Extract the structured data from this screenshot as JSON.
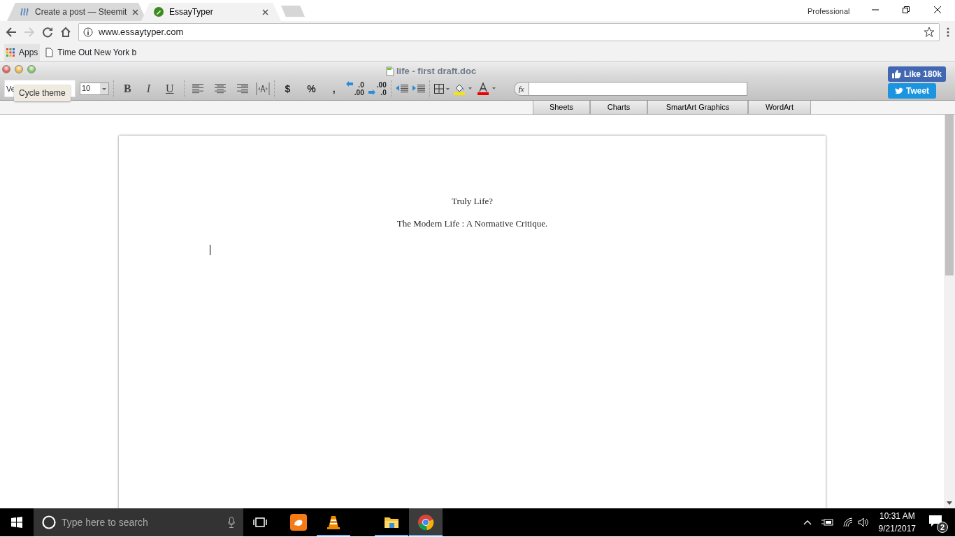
{
  "browser": {
    "tabs": [
      {
        "title": "Create a post — Steemit",
        "selected": false
      },
      {
        "title": "EssayTyper",
        "selected": true
      }
    ],
    "profile": "Professional",
    "address": "www.essaytyper.com",
    "bookmarks": [
      "Apps",
      "Time Out New York b"
    ]
  },
  "app": {
    "title": "life - first draft.doc",
    "like": "Like 180k",
    "tweet": "Tweet",
    "font_field": "Ve",
    "tooltip": "Cycle theme",
    "size_field": "10",
    "format_buttons": [
      "B",
      "I",
      "U"
    ],
    "number_buttons": [
      "$",
      "%",
      ","
    ],
    "decimal_buttons": [
      {
        "top": ".0",
        "bottom": ".00"
      },
      {
        "top": ".00",
        "bottom": ".0"
      }
    ],
    "formula_label": "fx",
    "sheet_tabs": [
      "Sheets",
      "Charts",
      "SmartArt Graphics",
      "WordArt"
    ]
  },
  "document": {
    "paragraphs": [
      "Truly Life?",
      "The Modern Life : A Normative Critique."
    ]
  },
  "taskbar": {
    "search_placeholder": "Type here to search",
    "apps": [
      {
        "kind": "uc",
        "running": false,
        "selected": false
      },
      {
        "kind": "vlc",
        "running": true,
        "selected": false
      },
      {
        "kind": "files",
        "running": true,
        "selected": false
      },
      {
        "kind": "chrome",
        "running": true,
        "selected": true
      }
    ],
    "time": "10:31 AM",
    "date": "9/21/2017",
    "notifications": "2"
  }
}
